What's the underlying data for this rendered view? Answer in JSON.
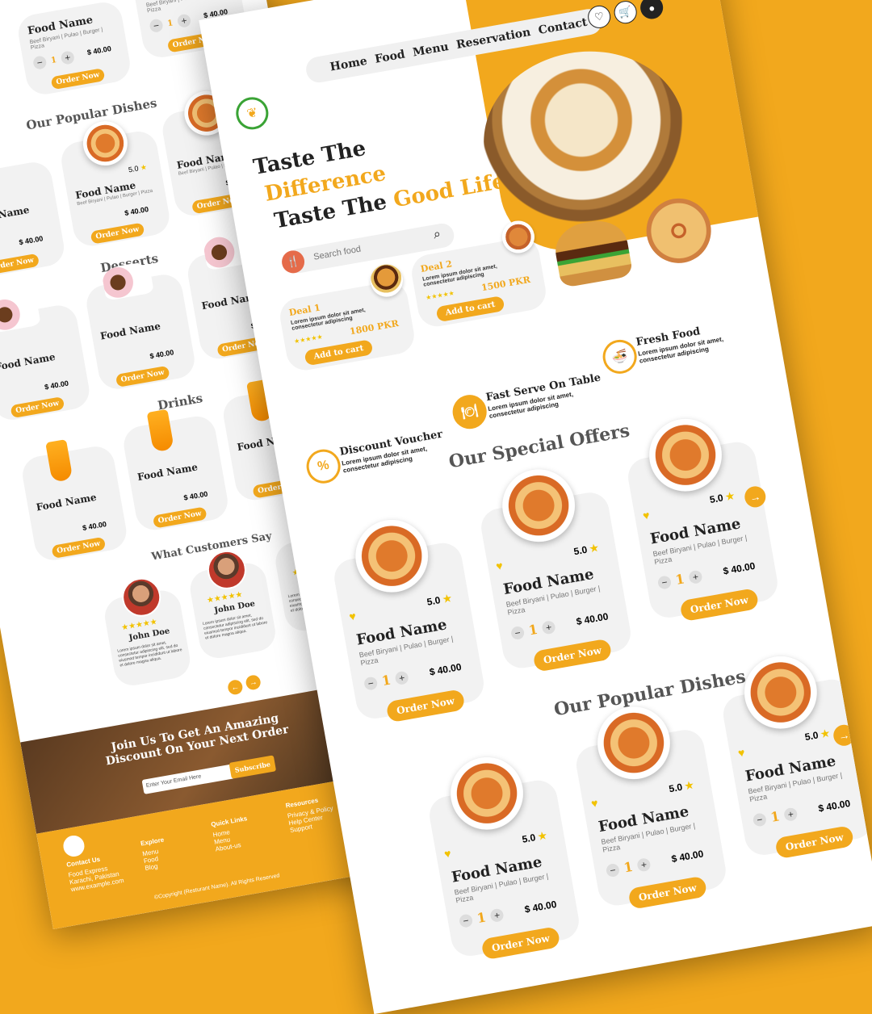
{
  "nav": {
    "items": [
      "Home",
      "Food",
      "Menu",
      "Reservation",
      "Contact"
    ]
  },
  "hero": {
    "title_line1": "Taste The",
    "title_line2": "Difference",
    "title_line3_a": "Taste The",
    "title_line3_b": "Good Life",
    "search_placeholder": "Search food"
  },
  "deals": [
    {
      "title": "Deal 1",
      "desc": "Lorem ipsum dolor sit amet, consectetur adipiscing",
      "price": "1800 PKR",
      "button": "Add to cart",
      "stars": "★★★★★"
    },
    {
      "title": "Deal 2",
      "desc": "Lorem ipsum dolor sit amet, consectetur adipiscing",
      "price": "1500 PKR",
      "button": "Add to cart",
      "stars": "★★★★★"
    }
  ],
  "features": [
    {
      "title": "Fresh Food",
      "desc": "Lorem ipsum dolor sit amet, consectetur adipiscing"
    },
    {
      "title": "Fast Serve On Table",
      "desc": "Lorem ipsum dolor sit amet, consectetur adipiscing"
    },
    {
      "title": "Discount Voucher",
      "desc": "Lorem ipsum dolor sit amet, consectetur adipiscing"
    }
  ],
  "food_card": {
    "name": "Food Name",
    "desc": "Beef Biryani | Pulao | Burger | Pizza",
    "rating": "5.0",
    "qty": "1",
    "price": "$ 40.00",
    "order": "Order Now",
    "minus": "−",
    "plus": "+"
  },
  "sections": {
    "special": "Our Special Offers",
    "popular": "Our Popular Dishes",
    "desserts": "Desserts",
    "drinks": "Drinks",
    "testimonials": "What Customers Say"
  },
  "testimonial": {
    "name": "John Doe",
    "text": "Lorem ipsum dolor sit amet, consectetur adipiscing elit, sed do eiusmod tempor incididunt ut labore et dolore magna aliqua.",
    "stars": "★★★★★"
  },
  "newsletter": {
    "title": "Join Us To Get An Amazing Discount On Your Next Order",
    "placeholder": "Enter Your Email Here",
    "button": "Subscribe"
  },
  "footer": {
    "contact": {
      "title": "Contact Us",
      "items": [
        "Food Express",
        "Karachi, Pakistan",
        "www.example.com"
      ]
    },
    "explore": {
      "title": "Explore",
      "items": [
        "Menu",
        "Food",
        "Blog"
      ]
    },
    "quick": {
      "title": "Quick Links",
      "items": [
        "Home",
        "Menu",
        "About-us"
      ]
    },
    "resources": {
      "title": "Resources",
      "items": [
        "Privacy & Policy",
        "Help Center",
        "Support"
      ]
    },
    "copyright": "©Copyright (Resturant Name). All Rights Reserved"
  },
  "colors": {
    "accent": "#f2a81d",
    "background": "#f2a81d"
  },
  "icons": [
    "heart-icon",
    "cart-icon",
    "user-icon",
    "search-icon",
    "logo-icon",
    "arrow-right-icon",
    "arrow-left-icon",
    "star-icon"
  ]
}
